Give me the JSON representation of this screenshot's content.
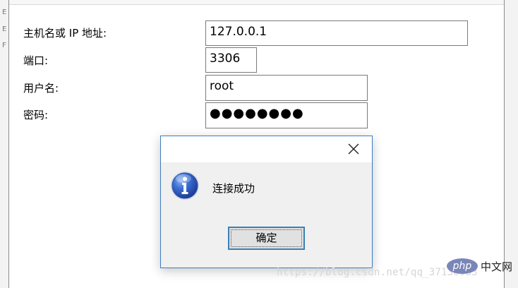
{
  "form": {
    "host_label": "主机名或 IP 地址:",
    "host_value": "127.0.0.1",
    "port_label": "端口:",
    "port_value": "3306",
    "user_label": "用户名:",
    "user_value": "root",
    "password_label": "密码:",
    "password_value": "●●●●●●●●"
  },
  "dialog": {
    "message": "连接成功",
    "ok_label": "确定",
    "close_icon": "close-icon",
    "info_icon": "info-icon",
    "accent_color": "#3c7fb1"
  },
  "watermark": {
    "url_text": "https://blog.csdn.net/qq_37130983",
    "logo_text": "php",
    "logo_cn": "中文网"
  },
  "backdrop": {
    "left_marks": [
      "E",
      "E",
      "F"
    ]
  }
}
